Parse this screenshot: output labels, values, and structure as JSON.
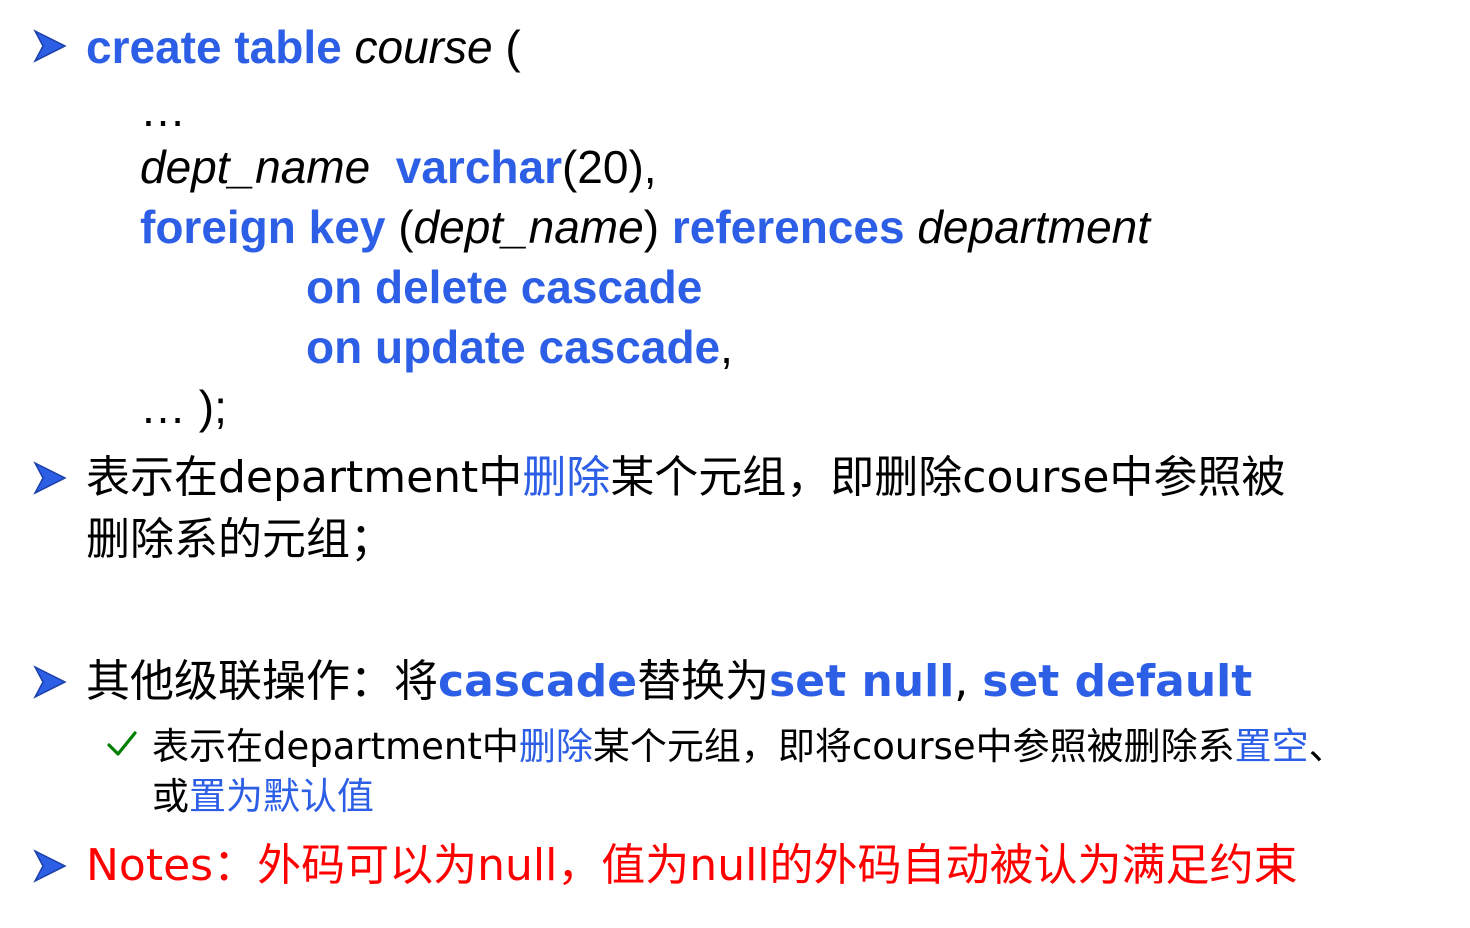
{
  "code": {
    "l1": {
      "create_table": "create table",
      "course": "course",
      "paren": " ("
    },
    "l2": "…",
    "l3": {
      "dept_name": "dept_name",
      "varchar": "varchar",
      "rest": "(20),"
    },
    "l4": {
      "foreign_key": "foreign key",
      "open": " (",
      "dept_name": "dept_name",
      "close": ")",
      "references": "references",
      "department": "department"
    },
    "l5": "on delete cascade",
    "l6": {
      "on_update": "on update cascade",
      "comma": ","
    },
    "l7": "… );"
  },
  "bullet2": {
    "part1": "表示在department中",
    "delete_word": "删除",
    "part2": "某个元组，即删除course中参照被",
    "line2": "删除系的元组；"
  },
  "bullet3": {
    "part1": "其他级联操作：将",
    "cascade": "cascade",
    "part2": "替换为",
    "set_null": "set null",
    "comma": ", ",
    "set_default": "set default"
  },
  "sub": {
    "part1": "表示在department中",
    "delete_word": "删除",
    "part2": "某个元组，即将course中参照被删除系",
    "set_empty": "置空",
    "part3": "、",
    "line2_a": "或",
    "line2_b": "置为默认值"
  },
  "notes": {
    "text": "Notes：外码可以为null，值为null的外码自动被认为满足约束"
  },
  "colors": {
    "keyword_blue": "#2d5ee6",
    "note_red": "#ff0000",
    "check_green": "#008000"
  },
  "icons": {
    "bullet": "arrow-bullet-icon",
    "check": "check-icon"
  }
}
